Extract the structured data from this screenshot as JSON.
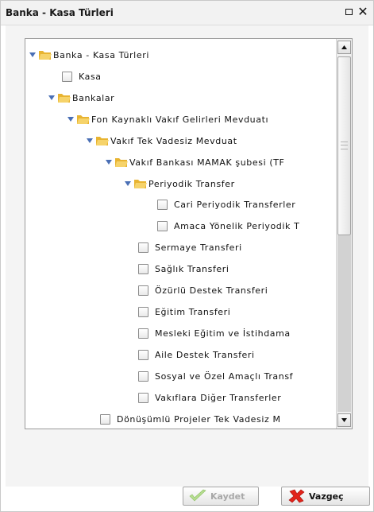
{
  "dialog": {
    "title": "Banka - Kasa Türleri",
    "icons": {
      "maximize": "maximize-icon",
      "close": "close-icon"
    }
  },
  "tree": {
    "nodes": [
      {
        "label": "Banka - Kasa Türleri",
        "type": "folder",
        "expanded": true
      },
      {
        "label": "Kasa",
        "type": "checkbox",
        "checked": false
      },
      {
        "label": "Bankalar",
        "type": "folder",
        "expanded": true
      },
      {
        "label": "Fon Kaynaklı Vakıf Gelirleri Mevduatı",
        "type": "folder",
        "expanded": true
      },
      {
        "label": "Vakıf Tek Vadesiz Mevduat",
        "type": "folder",
        "expanded": true
      },
      {
        "label": "Vakıf Bankası MAMAK şubesi (TF",
        "type": "folder",
        "expanded": true
      },
      {
        "label": "Periyodik Transfer",
        "type": "folder",
        "expanded": true
      },
      {
        "label": "Cari Periyodik Transferler",
        "type": "checkbox",
        "checked": false
      },
      {
        "label": "Amaca Yönelik Periyodik T",
        "type": "checkbox",
        "checked": false
      },
      {
        "label": "Sermaye Transferi",
        "type": "checkbox",
        "checked": false
      },
      {
        "label": "Sağlık Transferi",
        "type": "checkbox",
        "checked": false
      },
      {
        "label": "Özürlü Destek Transferi",
        "type": "checkbox",
        "checked": false
      },
      {
        "label": "Eğitim Transferi",
        "type": "checkbox",
        "checked": false
      },
      {
        "label": "Mesleki Eğitim ve İstihdama",
        "type": "checkbox",
        "checked": false
      },
      {
        "label": "Aile Destek Transferi",
        "type": "checkbox",
        "checked": false
      },
      {
        "label": "Sosyal ve Özel Amaçlı Transf",
        "type": "checkbox",
        "checked": false
      },
      {
        "label": "Vakıflara Diğer Transferler",
        "type": "checkbox",
        "checked": false
      },
      {
        "label": "Dönüşümlü Projeler  Tek Vadesiz M",
        "type": "checkbox",
        "checked": false
      }
    ]
  },
  "buttons": {
    "save": {
      "label": "Kaydet",
      "enabled": false,
      "icon": "checkmark-icon"
    },
    "cancel": {
      "label": "Vazgeç",
      "enabled": true,
      "icon": "red-x-icon"
    }
  },
  "colors": {
    "folder": "#f2c34a",
    "expander": "#4a6fb5",
    "cancel_icon": "#e2231a",
    "save_icon": "#7ac943"
  }
}
